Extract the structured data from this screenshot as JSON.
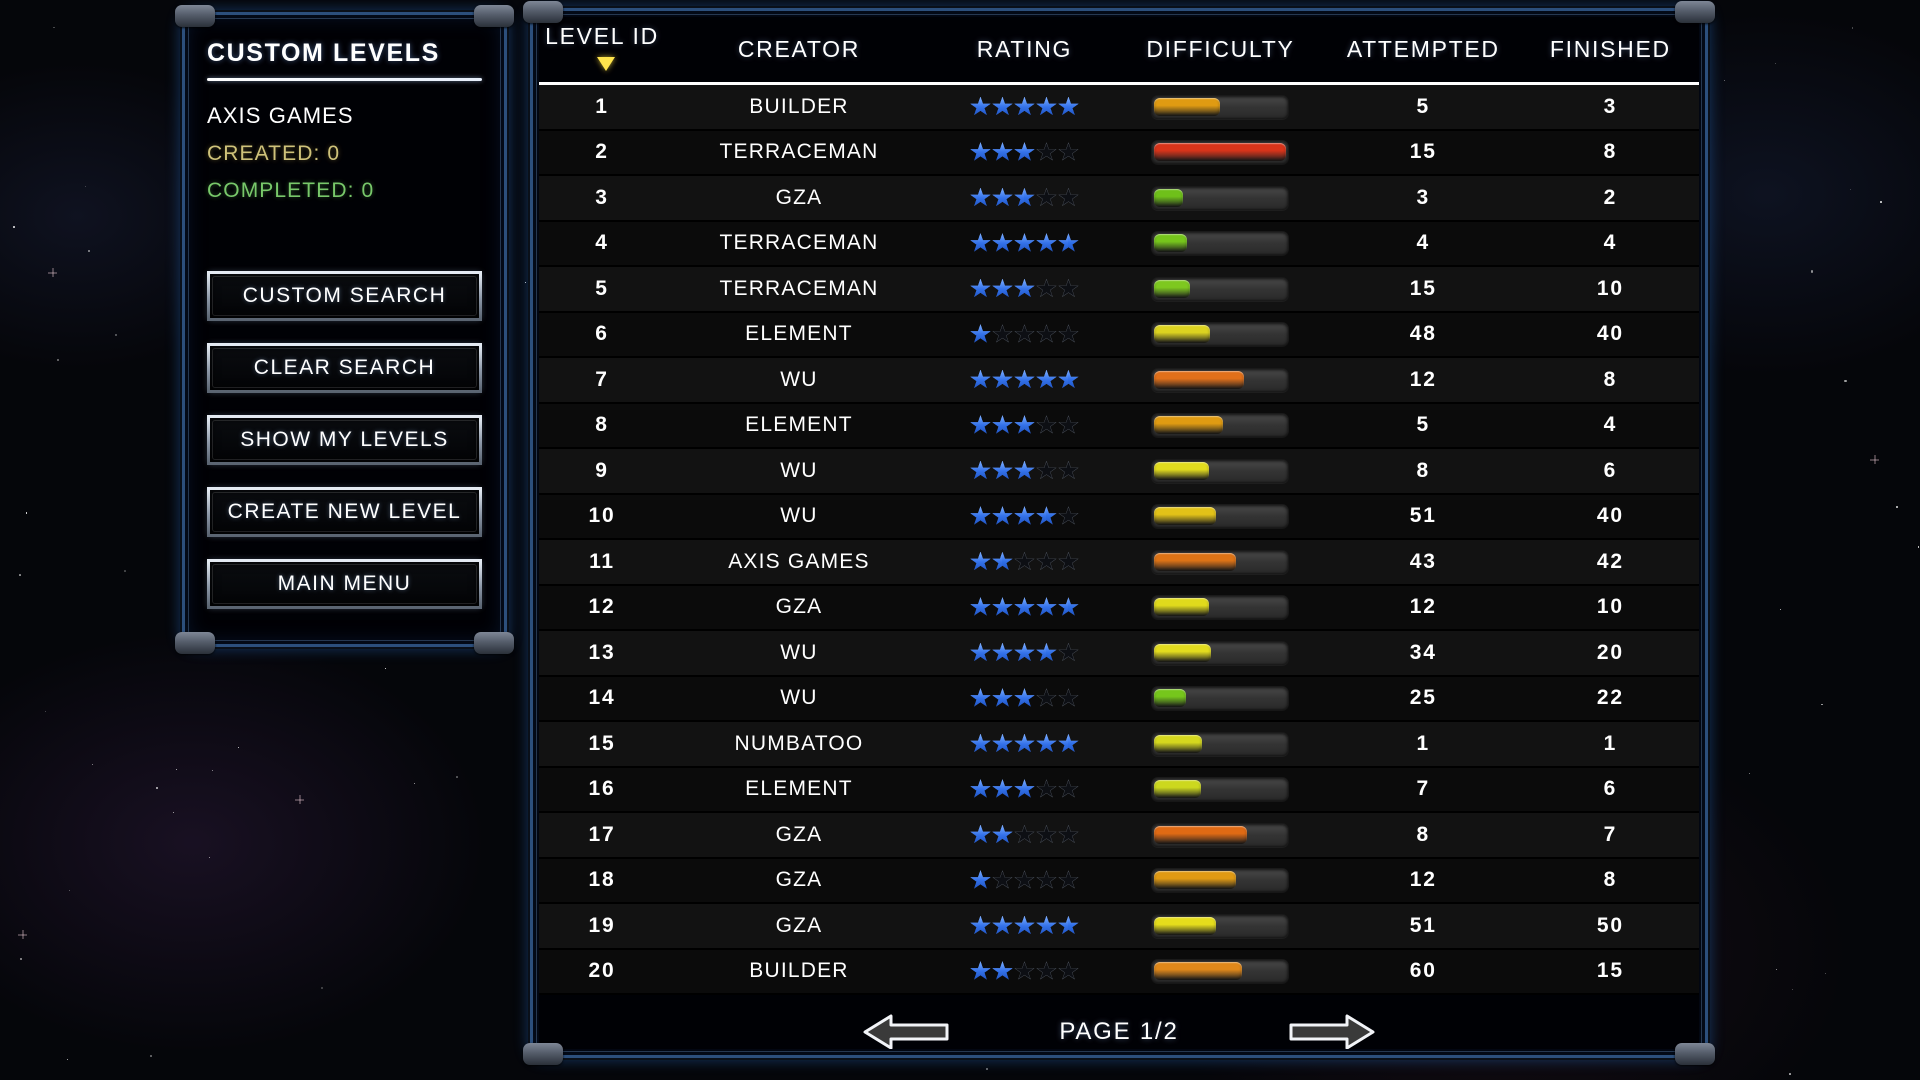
{
  "sidebar": {
    "title": "CUSTOM LEVELS",
    "user": "AXIS GAMES",
    "created_label": "CREATED: 0",
    "completed_label": "COMPLETED: 0",
    "buttons": [
      {
        "label": "CUSTOM SEARCH",
        "name": "custom-search-button"
      },
      {
        "label": "CLEAR SEARCH",
        "name": "clear-search-button"
      },
      {
        "label": "SHOW MY LEVELS",
        "name": "show-my-levels-button"
      },
      {
        "label": "CREATE NEW LEVEL",
        "name": "create-new-level-button"
      },
      {
        "label": "MAIN MENU",
        "name": "main-menu-button"
      }
    ]
  },
  "table": {
    "columns": [
      {
        "label": "LEVEL ID",
        "sorted": true,
        "sort_direction": "desc"
      },
      {
        "label": "CREATOR",
        "sorted": false
      },
      {
        "label": "RATING",
        "sorted": false
      },
      {
        "label": "DIFFICULTY",
        "sorted": false
      },
      {
        "label": "ATTEMPTED",
        "sorted": false
      },
      {
        "label": "FINISHED",
        "sorted": false
      }
    ],
    "rows": [
      {
        "id": "1",
        "creator": "BUILDER",
        "rating": 5.0,
        "difficulty": 0.5,
        "difficulty_color": "#e09b12",
        "attempted": "5",
        "finished": "3"
      },
      {
        "id": "2",
        "creator": "TERRACEMAN",
        "rating": 3.0,
        "difficulty": 1.0,
        "difficulty_color": "#d8341a",
        "attempted": "15",
        "finished": "8"
      },
      {
        "id": "3",
        "creator": "GZA",
        "rating": 2.5,
        "difficulty": 0.22,
        "difficulty_color": "#6fc01a",
        "attempted": "3",
        "finished": "2"
      },
      {
        "id": "4",
        "creator": "TERRACEMAN",
        "rating": 4.5,
        "difficulty": 0.25,
        "difficulty_color": "#76c61c",
        "attempted": "4",
        "finished": "4"
      },
      {
        "id": "5",
        "creator": "TERRACEMAN",
        "rating": 3.0,
        "difficulty": 0.27,
        "difficulty_color": "#7ec820",
        "attempted": "15",
        "finished": "10"
      },
      {
        "id": "6",
        "creator": "ELEMENT",
        "rating": 1.0,
        "difficulty": 0.42,
        "difficulty_color": "#dcd320",
        "attempted": "48",
        "finished": "40"
      },
      {
        "id": "7",
        "creator": "WU",
        "rating": 4.5,
        "difficulty": 0.68,
        "difficulty_color": "#e1701a",
        "attempted": "12",
        "finished": "8"
      },
      {
        "id": "8",
        "creator": "ELEMENT",
        "rating": 3.0,
        "difficulty": 0.52,
        "difficulty_color": "#e09b12",
        "attempted": "5",
        "finished": "4"
      },
      {
        "id": "9",
        "creator": "WU",
        "rating": 3.0,
        "difficulty": 0.41,
        "difficulty_color": "#e2dc1e",
        "attempted": "8",
        "finished": "6"
      },
      {
        "id": "10",
        "creator": "WU",
        "rating": 3.5,
        "difficulty": 0.47,
        "difficulty_color": "#e2c218",
        "attempted": "51",
        "finished": "40"
      },
      {
        "id": "11",
        "creator": "AXIS GAMES",
        "rating": 1.5,
        "difficulty": 0.62,
        "difficulty_color": "#dd7316",
        "attempted": "43",
        "finished": "42"
      },
      {
        "id": "12",
        "creator": "GZA",
        "rating": 4.5,
        "difficulty": 0.41,
        "difficulty_color": "#e0da1c",
        "attempted": "12",
        "finished": "10"
      },
      {
        "id": "13",
        "creator": "WU",
        "rating": 3.5,
        "difficulty": 0.43,
        "difficulty_color": "#e3dc1e",
        "attempted": "34",
        "finished": "20"
      },
      {
        "id": "14",
        "creator": "WU",
        "rating": 3.0,
        "difficulty": 0.24,
        "difficulty_color": "#76c61c",
        "attempted": "25",
        "finished": "22"
      },
      {
        "id": "15",
        "creator": "NUMBATOO",
        "rating": 4.5,
        "difficulty": 0.36,
        "difficulty_color": "#d5d81e",
        "attempted": "1",
        "finished": "1"
      },
      {
        "id": "16",
        "creator": "ELEMENT",
        "rating": 3.0,
        "difficulty": 0.35,
        "difficulty_color": "#ccd81e",
        "attempted": "7",
        "finished": "6"
      },
      {
        "id": "17",
        "creator": "GZA",
        "rating": 2.0,
        "difficulty": 0.7,
        "difficulty_color": "#e06a14",
        "attempted": "8",
        "finished": "7"
      },
      {
        "id": "18",
        "creator": "GZA",
        "rating": 1.0,
        "difficulty": 0.62,
        "difficulty_color": "#e09a14",
        "attempted": "12",
        "finished": "8"
      },
      {
        "id": "19",
        "creator": "GZA",
        "rating": 4.5,
        "difficulty": 0.47,
        "difficulty_color": "#e5dd1c",
        "attempted": "51",
        "finished": "50"
      },
      {
        "id": "20",
        "creator": "BUILDER",
        "rating": 2.0,
        "difficulty": 0.66,
        "difficulty_color": "#e0881a",
        "attempted": "60",
        "finished": "15"
      }
    ]
  },
  "footer": {
    "prev_label": "previous-page",
    "page_text": "PAGE 1/2",
    "next_label": "next-page"
  },
  "colors": {
    "panel_border": "#2c4f7c",
    "sort_arrow": "#ffe44d",
    "star_fill": "#2f6fe8",
    "created_text": "#cfc27a",
    "completed_text": "#78c86a"
  }
}
